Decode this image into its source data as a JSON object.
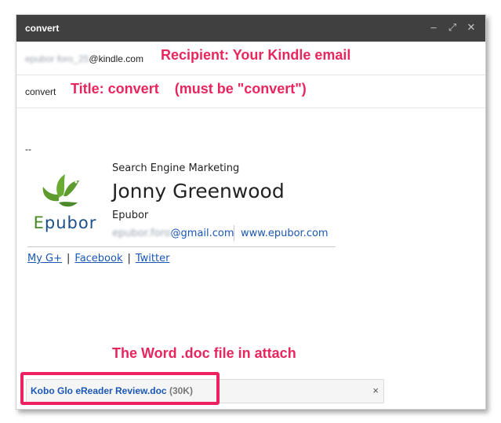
{
  "window": {
    "title": "convert",
    "controls": {
      "minimize": "–",
      "expand": "⤢",
      "close": "✕"
    }
  },
  "recipient": {
    "blurred_part": "epubor foro_25",
    "domain": "@kindle.com"
  },
  "subject": "convert",
  "annotations": {
    "recipient": "Recipient: Your Kindle email",
    "title": "Title: convert    (must be \"convert\")",
    "attachment": "The Word .doc file in attach"
  },
  "signature": {
    "separator": "--",
    "logo_text_first": "E",
    "logo_text_rest": "pubor",
    "job_title": "Search Engine Marketing",
    "name": "Jonny Greenwood",
    "company": "Epubor",
    "email_blurred": "epubor.foro",
    "email_domain": "@gmail.com",
    "website": "www.epubor.com",
    "social": [
      "My G+",
      "Facebook",
      "Twitter"
    ],
    "social_separator": "|"
  },
  "attachment": {
    "file_name": "Kobo Glo eReader Review.doc",
    "size": "(30K)",
    "close_label": "×"
  },
  "colors": {
    "titlebar": "#404040",
    "annotation": "#e8265e",
    "link": "#1a57b4",
    "logo_green": "#4a8a2a"
  }
}
